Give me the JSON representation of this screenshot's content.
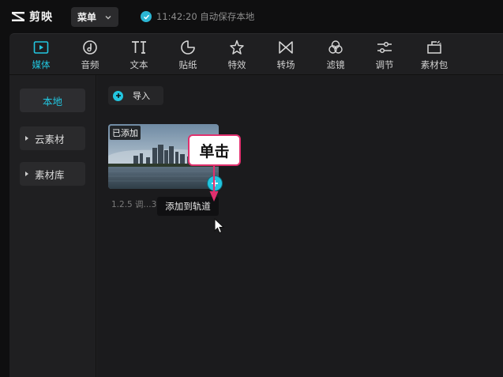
{
  "app": {
    "name": "剪映",
    "menu_label": "菜单",
    "autosave": "11:42:20 自动保存本地"
  },
  "toolbar": [
    {
      "label": "媒体",
      "icon": "media-icon",
      "active": true
    },
    {
      "label": "音频",
      "icon": "audio-icon"
    },
    {
      "label": "文本",
      "icon": "text-icon"
    },
    {
      "label": "贴纸",
      "icon": "sticker-icon"
    },
    {
      "label": "特效",
      "icon": "effects-icon"
    },
    {
      "label": "转场",
      "icon": "transition-icon"
    },
    {
      "label": "滤镜",
      "icon": "filter-icon"
    },
    {
      "label": "调节",
      "icon": "adjust-icon"
    },
    {
      "label": "素材包",
      "icon": "package-icon"
    }
  ],
  "sidebar": {
    "items": [
      {
        "label": "本地",
        "active": true
      },
      {
        "label": "云素材"
      },
      {
        "label": "素材库"
      }
    ]
  },
  "content": {
    "import_label": "导入",
    "clip": {
      "added_tag": "已添加",
      "meta": "1.2.5  调...3",
      "tooltip": "添加到轨道"
    },
    "callout": "单击"
  },
  "colors": {
    "accent": "#22c6e0",
    "callout_border": "#e0306e",
    "background": "#1b1b1d"
  }
}
